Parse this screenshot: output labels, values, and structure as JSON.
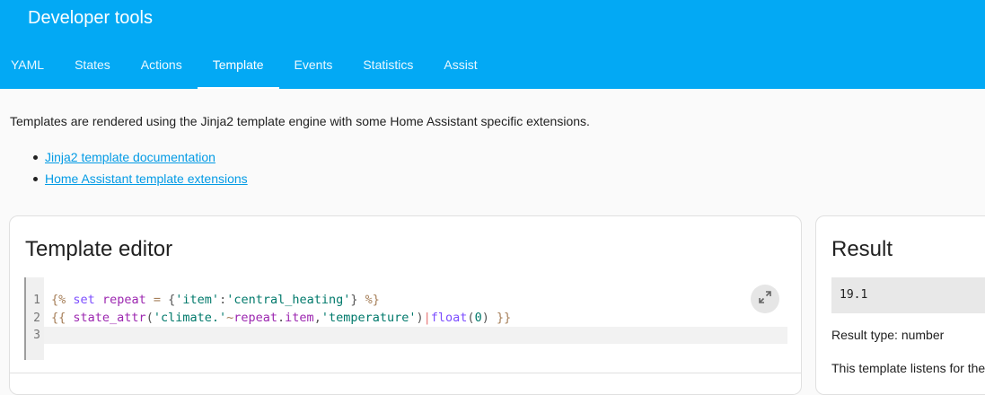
{
  "header": {
    "title": "Developer tools",
    "tabs": [
      {
        "label": "YAML"
      },
      {
        "label": "States"
      },
      {
        "label": "Actions"
      },
      {
        "label": "Template"
      },
      {
        "label": "Events"
      },
      {
        "label": "Statistics"
      },
      {
        "label": "Assist"
      }
    ],
    "active_tab": "Template",
    "background_color": "#03a9f4"
  },
  "intro": {
    "text": "Templates are rendered using the Jinja2 template engine with some Home Assistant specific extensions.",
    "links": [
      {
        "label": "Jinja2 template documentation"
      },
      {
        "label": "Home Assistant template extensions"
      }
    ]
  },
  "editor": {
    "title": "Template editor",
    "line_numbers": [
      "1",
      "2",
      "3"
    ],
    "lines": [
      "{% set repeat = {'item':'central_heating'} %}",
      "{{ state_attr('climate.'~repeat.item,'temperature')|float(0) }}",
      ""
    ],
    "expand_icon": "expand-arrows-icon"
  },
  "result": {
    "title": "Result",
    "value": "19.1",
    "type_text": "Result type: number",
    "listen_text": "This template listens for the"
  }
}
